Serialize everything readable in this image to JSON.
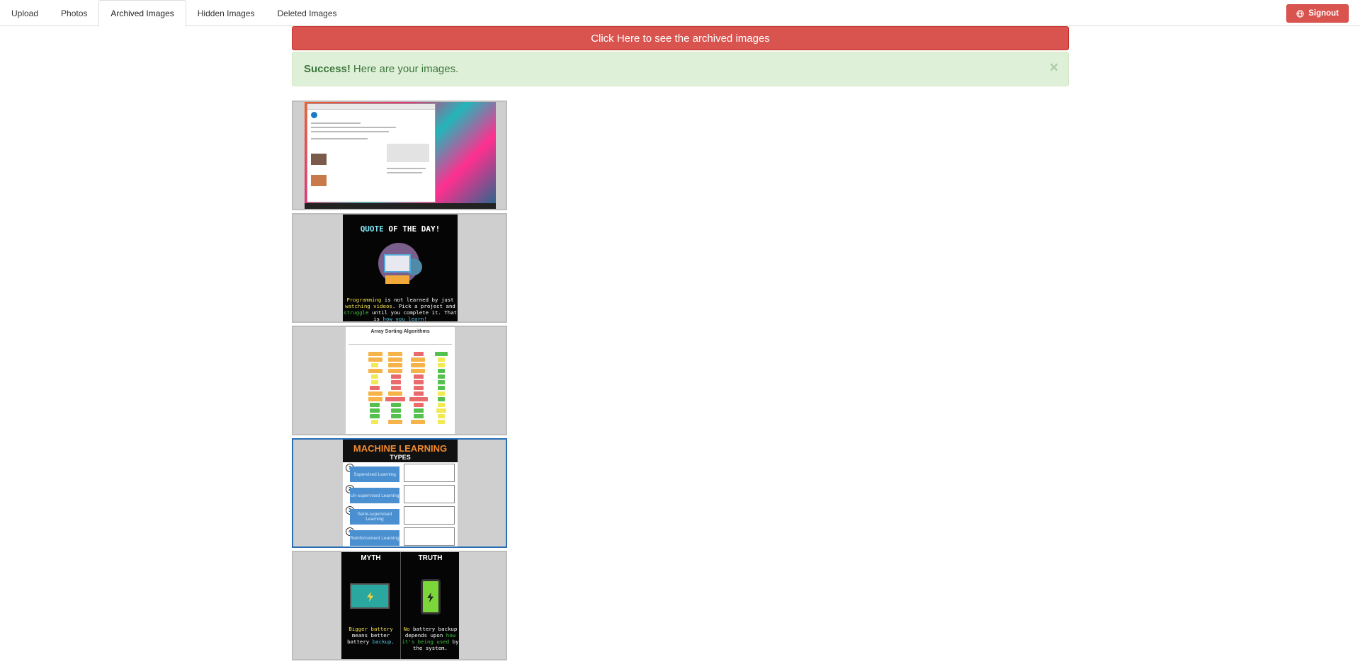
{
  "nav": {
    "tabs": [
      {
        "label": "Upload"
      },
      {
        "label": "Photos"
      },
      {
        "label": "Archived Images"
      },
      {
        "label": "Hidden Images"
      },
      {
        "label": "Deleted Images"
      }
    ],
    "active_tab": "Archived Images",
    "signout_label": "Signout"
  },
  "banner": {
    "archive_button_label": "Click Here to see the archived images",
    "alert_strong": "Success!",
    "alert_text": "Here are your images.",
    "alert_close": "×"
  },
  "images": [
    {
      "name": "Screenshot of registration confirmation page"
    },
    {
      "title_a": "QUOTE",
      "title_b": " OF THE DAY!",
      "q1": "Programming",
      "q2": " is not learned by just ",
      "q3": "watching videos",
      "q4": ". Pick a project and ",
      "q5": "struggle",
      "q6": " until you complete it. That is ",
      "q7": "how you learn!"
    },
    {
      "title": "Array Sorting Algorithms"
    },
    {
      "title": "MACHINE LEARNING",
      "subtitle": "TYPES",
      "types": [
        "Supervised Learning",
        "Un-supervised Learning",
        "Semi-supervised Learning",
        "Reinforcement Learning"
      ],
      "numbers": [
        "1",
        "2",
        "3",
        "4"
      ]
    },
    {
      "left_head": "MYTH",
      "right_head": "TRUTH",
      "l1": "Bigger battery",
      "l2": " means better battery ",
      "l3": "backup",
      "l4": ".",
      "r1": "No",
      "r2": " battery backup depends upon ",
      "r3": "how it's being used",
      "r4": " by the system."
    }
  ],
  "colors": {
    "danger": "#d9534f",
    "success_bg": "#dff0d8",
    "success_text": "#3c763d",
    "selected_border": "#2a6db5"
  },
  "icons": {
    "signout": "globe-icon",
    "alert_close": "close-icon"
  }
}
